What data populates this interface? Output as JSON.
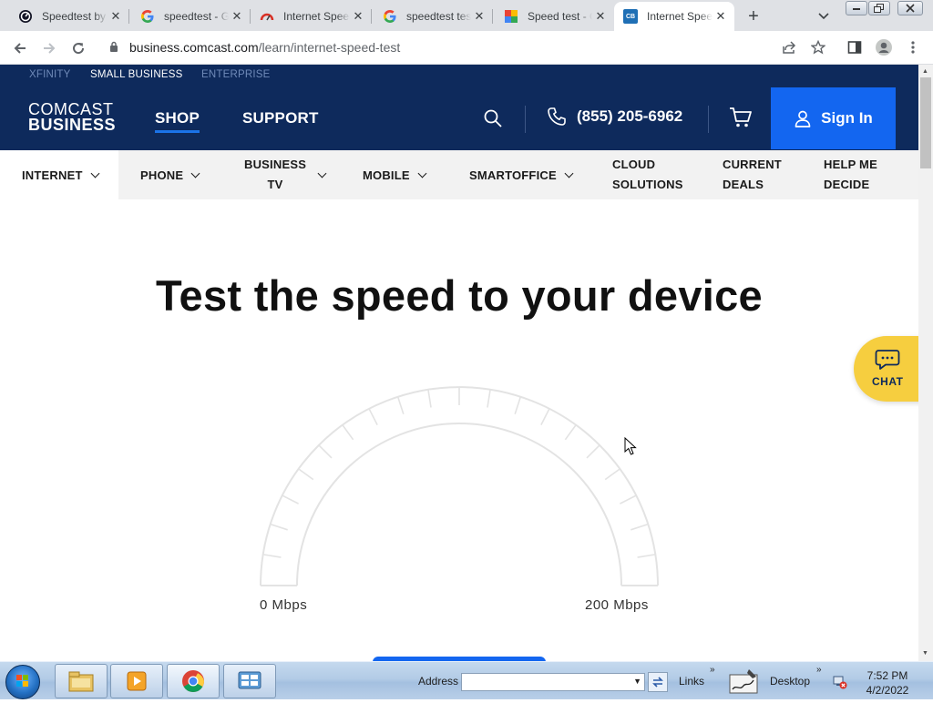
{
  "browser": {
    "tabs": [
      {
        "title": "Speedtest by Ookla",
        "icon": "speedtest-icon"
      },
      {
        "title": "speedtest - Google Search",
        "icon": "google-icon"
      },
      {
        "title": "Internet Speed Test",
        "icon": "gauge-icon"
      },
      {
        "title": "speedtest test - Google Search",
        "icon": "google-icon"
      },
      {
        "title": "Speed test - Google",
        "icon": "photos-icon"
      },
      {
        "title": "Internet Speed Test",
        "icon": "comcast-business-icon",
        "favicon_text": "CB"
      }
    ],
    "url_host": "business.comcast.com",
    "url_path": "/learn/internet-speed-test"
  },
  "site": {
    "top_links": [
      {
        "label": "XFINITY",
        "active": false
      },
      {
        "label": "SMALL BUSINESS",
        "active": true
      },
      {
        "label": "ENTERPRISE",
        "active": false
      }
    ],
    "logo_line1": "COMCAST",
    "logo_line2": "BUSINESS",
    "main_links": [
      {
        "label": "SHOP",
        "active": true
      },
      {
        "label": "SUPPORT",
        "active": false
      }
    ],
    "phone": "(855) 205-6962",
    "sign_in": "Sign In",
    "subnav": [
      {
        "label": "INTERNET",
        "dropdown": true
      },
      {
        "label": "PHONE",
        "dropdown": true
      },
      {
        "label_line1": "BUSINESS",
        "label_line2": "TV",
        "dropdown": true
      },
      {
        "label": "MOBILE",
        "dropdown": true
      },
      {
        "label": "SMARTOFFICE",
        "dropdown": true
      },
      {
        "label_line1": "CLOUD",
        "label_line2": "SOLUTIONS",
        "dropdown": false
      },
      {
        "label_line1": "CURRENT",
        "label_line2": "DEALS",
        "dropdown": false
      },
      {
        "label_line1": "HELP ME",
        "label_line2": "DECIDE",
        "dropdown": false
      }
    ],
    "hero_title": "Test the speed to your device",
    "chat_label": "CHAT",
    "gauge": {
      "min_label": "0 Mbps",
      "max_label": "200 Mbps",
      "value": 0
    },
    "colors": {
      "navy": "#0e2a5c",
      "blue": "#1366f0",
      "chat": "#f6ce3f"
    }
  },
  "taskbar": {
    "address_label": "Address",
    "address_value": "",
    "links_label": "Links",
    "desktop_label": "Desktop",
    "time": "7:52 PM",
    "date": "4/2/2022"
  }
}
